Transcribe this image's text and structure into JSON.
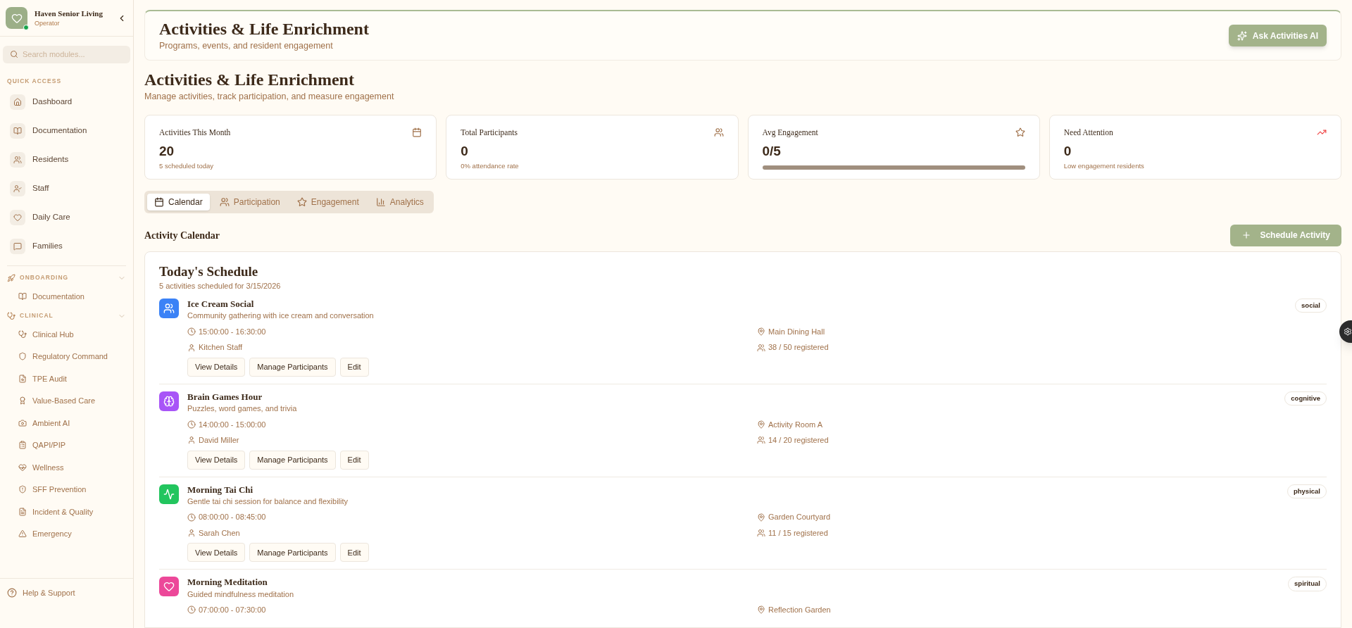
{
  "sidebar": {
    "org": {
      "name": "Haven Senior Living",
      "role": "Operator",
      "online": true
    },
    "search": {
      "placeholder": "Search modules..."
    },
    "quick_access": {
      "title": "QUICK ACCESS",
      "items": [
        {
          "label": "Dashboard"
        },
        {
          "label": "Documentation"
        },
        {
          "label": "Residents"
        },
        {
          "label": "Staff"
        },
        {
          "label": "Daily Care"
        },
        {
          "label": "Families"
        }
      ]
    },
    "groups": [
      {
        "title": "ONBOARDING",
        "expanded": true,
        "items": [
          {
            "label": "Documentation"
          }
        ]
      },
      {
        "title": "CLINICAL",
        "expanded": true,
        "items": [
          {
            "label": "Clinical Hub"
          },
          {
            "label": "Regulatory Command"
          },
          {
            "label": "TPE Audit"
          },
          {
            "label": "Value-Based Care"
          },
          {
            "label": "Ambient AI"
          },
          {
            "label": "QAPI/PIP"
          },
          {
            "label": "Wellness"
          },
          {
            "label": "SFF Prevention"
          },
          {
            "label": "Incident & Quality"
          },
          {
            "label": "Emergency"
          }
        ]
      }
    ],
    "help": "Help & Support"
  },
  "header": {
    "title": "Activities & Life Enrichment",
    "subtitle": "Programs, events, and resident engagement",
    "button": "Ask Activities AI"
  },
  "page": {
    "title": "Activities & Life Enrichment",
    "subtitle": "Manage activities, track participation, and measure engagement"
  },
  "stats": [
    {
      "kind": "plain",
      "label": "Activities This Month",
      "value": "20",
      "note": "5 scheduled today"
    },
    {
      "kind": "plain",
      "label": "Total Participants",
      "value": "0",
      "note": "0% attendance rate"
    },
    {
      "kind": "meter",
      "label": "Avg Engagement",
      "value": "0/5",
      "level": 0
    },
    {
      "kind": "plain",
      "label": "Need Attention",
      "value": "0",
      "note": "Low engagement residents"
    }
  ],
  "tabs": [
    {
      "label": "Calendar",
      "selected": true
    },
    {
      "label": "Participation",
      "selected": false
    },
    {
      "label": "Engagement",
      "selected": false
    },
    {
      "label": "Analytics",
      "selected": false
    }
  ],
  "section": {
    "title": "Activity Calendar",
    "button": "Schedule Activity"
  },
  "schedule": {
    "title": "Today's Schedule",
    "subtitle": "5 activities scheduled for 3/15/2026",
    "activities": [
      {
        "name": "Ice Cream Social",
        "description": "Community gathering with ice cream and conversation",
        "time": "15:00:00 - 16:30:00",
        "leader": "Kitchen Staff",
        "location": "Main Dining Hall",
        "registered": "38 / 50 registered",
        "actions": [
          "View Details",
          "Manage Participants",
          "Edit"
        ],
        "category": "social",
        "color": "#3b82f6"
      },
      {
        "name": "Brain Games Hour",
        "description": "Puzzles, word games, and trivia",
        "time": "14:00:00 - 15:00:00",
        "leader": "David Miller",
        "location": "Activity Room A",
        "registered": "14 / 20 registered",
        "actions": [
          "View Details",
          "Manage Participants",
          "Edit"
        ],
        "category": "cognitive",
        "color": "#a855f7"
      },
      {
        "name": "Morning Tai Chi",
        "description": "Gentle tai chi session for balance and flexibility",
        "time": "08:00:00 - 08:45:00",
        "leader": "Sarah Chen",
        "location": "Garden Courtyard",
        "registered": "11 / 15 registered",
        "actions": [
          "View Details",
          "Manage Participants",
          "Edit"
        ],
        "category": "physical",
        "color": "#22c55e"
      },
      {
        "name": "Morning Meditation",
        "description": "Guided mindfulness meditation",
        "time": "07:00:00 - 07:30:00",
        "location": "Reflection Garden",
        "category": "spiritual",
        "color": "#ec4899"
      }
    ]
  }
}
